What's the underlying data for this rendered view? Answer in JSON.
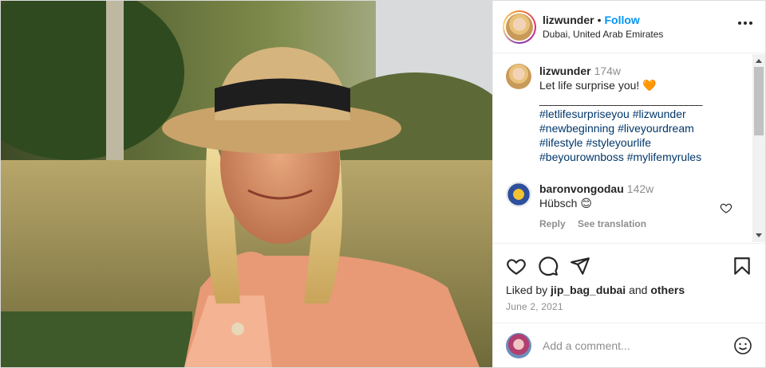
{
  "post": {
    "author": "lizwunder",
    "separator": "•",
    "follow_label": "Follow",
    "location": "Dubai, United Arab Emirates",
    "photo_alt": "photo-icon"
  },
  "caption": {
    "user": "lizwunder",
    "time": "174w",
    "text": "Let life surprise you! 🧡",
    "rule": "______________________________",
    "tags_line1": "#letlifesurpriseyou #lizwunder",
    "tags_line2": "#newbeginning #liveyourdream",
    "tags_line3": "#lifestyle #styleyourlife",
    "tags_line4": "#beyourownboss #mylifemyrules"
  },
  "comment": {
    "user": "baronvongodau",
    "time": "142w",
    "text": "Hübsch 😊",
    "reply_label": "Reply",
    "translate_label": "See translation"
  },
  "likes": {
    "prefix": "Liked by",
    "user": "jip_bag_dubai",
    "and": "and",
    "others": "others"
  },
  "date": "June 2, 2021",
  "add_comment": {
    "placeholder": "Add a comment..."
  }
}
